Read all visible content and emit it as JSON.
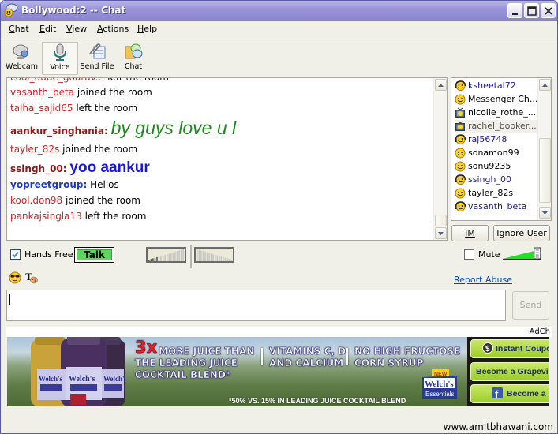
{
  "window": {
    "title": "Bollywood:2 -- Chat",
    "controls": [
      "minimize",
      "maximize",
      "close"
    ]
  },
  "menu": [
    {
      "label": "Chat",
      "accel": "C"
    },
    {
      "label": "Edit",
      "accel": "E"
    },
    {
      "label": "View",
      "accel": "V"
    },
    {
      "label": "Actions",
      "accel": "A"
    },
    {
      "label": "Help",
      "accel": "H"
    }
  ],
  "toolbar": [
    {
      "label": "Webcam",
      "icon": "webcam-icon"
    },
    {
      "label": "Voice",
      "icon": "microphone-icon",
      "active": true
    },
    {
      "label": "Send File",
      "icon": "paperclip-icon"
    },
    {
      "label": "Chat",
      "icon": "chat-bubbles-icon"
    }
  ],
  "chat_log": [
    {
      "type": "system",
      "nick": "cool_dude_gourav...",
      "text": "left the room",
      "partial": true
    },
    {
      "type": "system",
      "nick": "vasanth_beta",
      "text": "joined the room"
    },
    {
      "type": "system",
      "nick": "talha_sajid65",
      "text": "left the room"
    },
    {
      "type": "message",
      "nick": "aankur_singhania:",
      "text": "by guys love u l",
      "nick_color": "#8b1a1a",
      "text_color": "#1f8a1f",
      "style": "italic-large"
    },
    {
      "type": "system",
      "nick": "tayler_82s",
      "text": "joined the room"
    },
    {
      "type": "message",
      "nick": "ssingh_00:",
      "text": "yoo aankur",
      "nick_color": "#8b1a1a",
      "text_color": "#1a1ad0",
      "style": "bold-large"
    },
    {
      "type": "message",
      "nick": "yopreetgroup:",
      "text": "Hellos",
      "nick_color": "#1a3ac8",
      "text_color": "#000000",
      "style": "normal"
    },
    {
      "type": "system",
      "nick": "kool.don98",
      "text": "joined the room"
    },
    {
      "type": "system",
      "nick": "pankajsingla13",
      "text": "left the room"
    }
  ],
  "users": [
    {
      "name": "ksheetal72",
      "icon": "voice-smiley-icon",
      "color": "#1a1a8c"
    },
    {
      "name": "Messenger Ch...",
      "icon": "smiley-icon",
      "color": "#000000"
    },
    {
      "name": "nicolle_rothe_...",
      "icon": "webcam-tv-icon",
      "color": "#000000"
    },
    {
      "name": "rachel_booker...",
      "icon": "webcam-tv-icon",
      "color": "#555555",
      "selected": true
    },
    {
      "name": "raj56748",
      "icon": "voice-smiley-icon",
      "color": "#1a1a8c"
    },
    {
      "name": "sonamon99",
      "icon": "smiley-icon",
      "color": "#000000"
    },
    {
      "name": "sonu9235",
      "icon": "smiley-icon",
      "color": "#000000"
    },
    {
      "name": "ssingh_00",
      "icon": "voice-smiley-icon",
      "color": "#1a1a8c"
    },
    {
      "name": "tayler_82s",
      "icon": "smiley-icon",
      "color": "#000000"
    },
    {
      "name": "vasanth_beta",
      "icon": "voice-smiley-icon",
      "color": "#1a1a8c"
    }
  ],
  "user_buttons": {
    "im": "IM",
    "ignore": "Ignore User"
  },
  "voice": {
    "hands_free_label": "Hands Free",
    "hands_free_checked": true,
    "talk_label": "Talk",
    "mute_label": "Mute",
    "mute_checked": false,
    "volume_level": 0.85
  },
  "report_abuse": "Report Abuse",
  "message_input": {
    "value": ""
  },
  "send_label": "Send",
  "ad": {
    "header": "AdCh",
    "headline_3x": "3x",
    "headline_1": "MORE JUICE THAN",
    "headline_2": "THE LEADING JUICE",
    "headline_3": "COCKTAIL BLEND*",
    "col2_1": "VITAMINS C, D",
    "col2_2": "AND CALCIUM",
    "col3_1": "NO HIGH FRUCTOSE",
    "col3_2": "CORN SYRUP",
    "footnote": "*50% VS. 15% IN LEADING JUICE COCKTAIL BLEND",
    "logo_new": "NEW",
    "logo_brand": "Welch's",
    "logo_sub": "Essentials",
    "bottle_brand": "Welch's",
    "buttons": [
      "Instant Coupon",
      "Become a Grapevine In",
      "Become a Fan"
    ]
  },
  "watermark": "www.amitbhawani.com"
}
